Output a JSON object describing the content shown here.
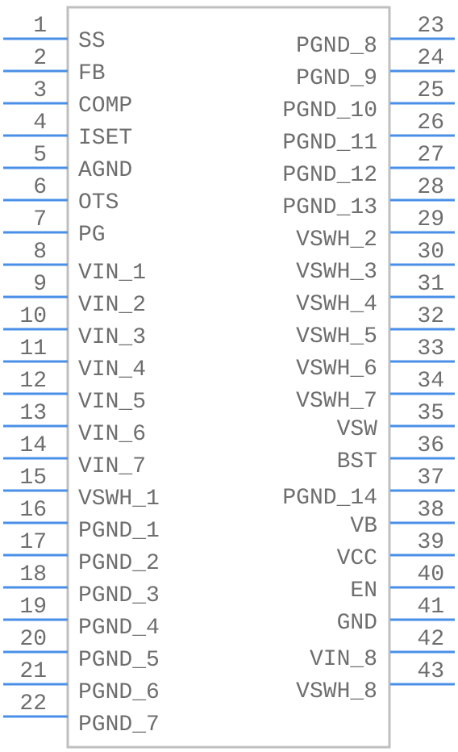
{
  "component": {
    "colors": {
      "pin": "#4a8fe7",
      "body_border": "#bfbfbf",
      "text": "#6e6e6e"
    },
    "left_pins": [
      {
        "number": "1",
        "name": "SS"
      },
      {
        "number": "2",
        "name": "FB"
      },
      {
        "number": "3",
        "name": "COMP"
      },
      {
        "number": "4",
        "name": "ISET"
      },
      {
        "number": "5",
        "name": "AGND"
      },
      {
        "number": "6",
        "name": "OTS"
      },
      {
        "number": "7",
        "name": "PG"
      },
      {
        "number": "8",
        "name": "VIN_1"
      },
      {
        "number": "9",
        "name": "VIN_2"
      },
      {
        "number": "10",
        "name": "VIN_3"
      },
      {
        "number": "11",
        "name": "VIN_4"
      },
      {
        "number": "12",
        "name": "VIN_5"
      },
      {
        "number": "13",
        "name": "VIN_6"
      },
      {
        "number": "14",
        "name": "VIN_7"
      },
      {
        "number": "15",
        "name": "VSWH_1"
      },
      {
        "number": "16",
        "name": "PGND_1"
      },
      {
        "number": "17",
        "name": "PGND_2"
      },
      {
        "number": "18",
        "name": "PGND_3"
      },
      {
        "number": "19",
        "name": "PGND_4"
      },
      {
        "number": "20",
        "name": "PGND_5"
      },
      {
        "number": "21",
        "name": "PGND_6"
      },
      {
        "number": "22",
        "name": "PGND_7"
      }
    ],
    "right_pins": [
      {
        "number": "23",
        "name": "PGND_8"
      },
      {
        "number": "24",
        "name": "PGND_9"
      },
      {
        "number": "25",
        "name": "PGND_10"
      },
      {
        "number": "26",
        "name": "PGND_11"
      },
      {
        "number": "27",
        "name": "PGND_12"
      },
      {
        "number": "28",
        "name": "PGND_13"
      },
      {
        "number": "29",
        "name": "VSWH_2"
      },
      {
        "number": "30",
        "name": "VSWH_3"
      },
      {
        "number": "31",
        "name": "VSWH_4"
      },
      {
        "number": "32",
        "name": "VSWH_5"
      },
      {
        "number": "33",
        "name": "VSWH_6"
      },
      {
        "number": "34",
        "name": "VSWH_7"
      },
      {
        "number": "35",
        "name": "VSW"
      },
      {
        "number": "36",
        "name": "BST"
      },
      {
        "number": "37",
        "name": "PGND_14"
      },
      {
        "number": "38",
        "name": "VB"
      },
      {
        "number": "39",
        "name": "VCC"
      },
      {
        "number": "40",
        "name": "EN"
      },
      {
        "number": "41",
        "name": "GND"
      },
      {
        "number": "42",
        "name": "VIN_8"
      },
      {
        "number": "43",
        "name": "VSWH_8"
      }
    ]
  }
}
